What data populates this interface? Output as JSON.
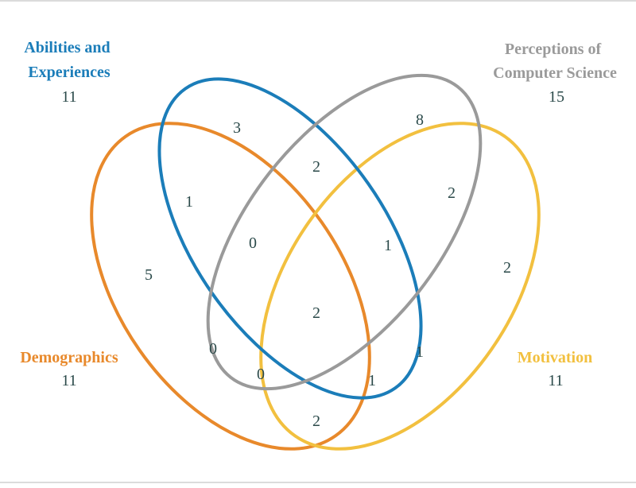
{
  "sets": {
    "abilities": {
      "title_lines": [
        "Abilities and",
        "Experiences"
      ],
      "count": "11",
      "color": "#1b7db9"
    },
    "perceptions": {
      "title_lines": [
        "Perceptions of",
        "Computer Science"
      ],
      "count": "15",
      "color": "#9a9a9a"
    },
    "demographics": {
      "title_lines": [
        "Demographics"
      ],
      "count": "11",
      "color": "#e8892b"
    },
    "motivation": {
      "title_lines": [
        "Motivation"
      ],
      "count": "11",
      "color": "#f2c03f"
    }
  },
  "regions": {
    "abilities_only": "3",
    "perceptions_only": "8",
    "demographics_only": "5",
    "motivation_only": "2",
    "abilities_perceptions": "2",
    "abilities_demographics": "1",
    "perceptions_motivation": "2",
    "abilities_perceptions_demographics": "0",
    "abilities_perceptions_motivation": "1",
    "all_four": "2",
    "perceptions_demographics": "0",
    "abilities_motivation": "1",
    "perceptions_demographics_motivation": "0",
    "abilities_demographics_motivation": "1",
    "demographics_motivation": "2"
  }
}
